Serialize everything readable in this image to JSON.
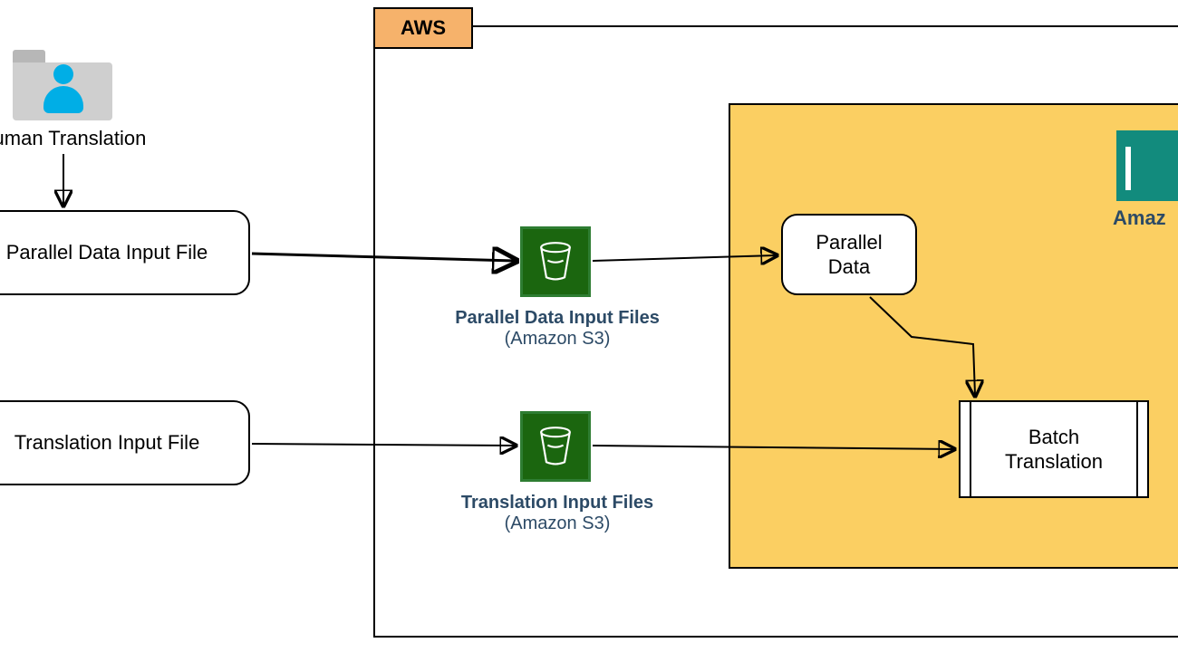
{
  "human": {
    "label": "Human Translation"
  },
  "parallel_file": {
    "label": "Parallel Data Input File"
  },
  "translation_file": {
    "label": "Translation Input File"
  },
  "aws_tab": {
    "label": "AWS"
  },
  "s3_parallel": {
    "title": "Parallel Data Input Files",
    "sub": "(Amazon S3)"
  },
  "s3_translation": {
    "title": "Translation Input Files",
    "sub": "(Amazon S3)"
  },
  "parallel_data": {
    "label": "Parallel\nData"
  },
  "batch_translation": {
    "label": "Batch\nTranslation"
  },
  "amazon_translate": {
    "label": "Amaz"
  }
}
